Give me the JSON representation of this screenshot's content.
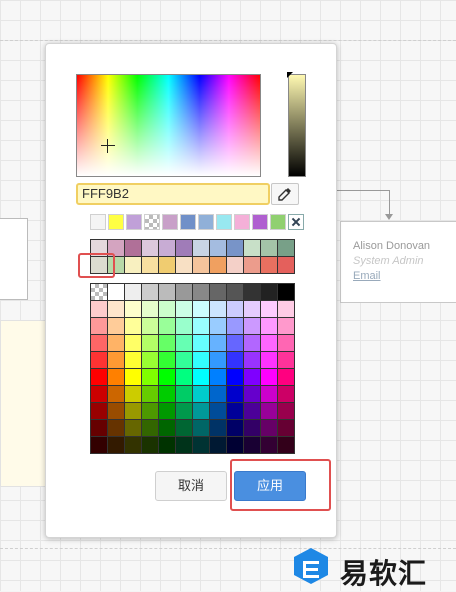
{
  "background": {
    "person_card": {
      "name": "Alison Donovan",
      "role": "System Admin",
      "email_label": "Email"
    }
  },
  "color_picker": {
    "hex_value": "FFF9B2",
    "hue_gradient": [
      "#ff0000",
      "#ffff00",
      "#00ff00",
      "#00ffff",
      "#0000ff",
      "#ff00ff",
      "#ff0000"
    ],
    "brightness_gradient": [
      "#fff9b2",
      "#7f7c59",
      "#000000"
    ],
    "recent_colors": [
      "#f4f4f4",
      "#ffff44",
      "#c0a0d8",
      "checker",
      "#c8a0c8",
      "#7090c8",
      "#90b0d8",
      "#98e8f0",
      "#f4b0d8",
      "#b060d0",
      "#90d070",
      "none"
    ],
    "theme_colors_row1": [
      "#e4d8dc",
      "#d4a4c0",
      "#b07098",
      "#dcc8dc",
      "#c8acd4",
      "#a07cb8",
      "#c8d4e4",
      "#a4bce0",
      "#7894c8",
      "#c8e0c8",
      "#a4c4a8",
      "#78a088"
    ],
    "theme_colors_row2": [
      "#dcdcd0",
      "#b8d8a8",
      "#f8f0c0",
      "#f8e0a0",
      "#f0cc70",
      "#f8e0c4",
      "#f4c49c",
      "#f0a060",
      "#f4d0c8",
      "#ec9c8c",
      "#e87060",
      "#e4605c"
    ],
    "palette_rows": [
      [
        "checker",
        "#ffffff",
        "#eeeeee",
        "#cccccc",
        "#bbbbbb",
        "#999999",
        "#888888",
        "#666666",
        "#555555",
        "#333333",
        "#222222",
        "#000000"
      ],
      [
        "#ffcccc",
        "#ffe6cc",
        "#ffffcc",
        "#e6ffcc",
        "#ccffcc",
        "#ccffe6",
        "#ccffff",
        "#cce5ff",
        "#ccccff",
        "#e5ccff",
        "#ffccff",
        "#ffcce5"
      ],
      [
        "#ff9999",
        "#ffcc99",
        "#ffff99",
        "#ccff99",
        "#99ff99",
        "#99ffcc",
        "#99ffff",
        "#99ccff",
        "#9999ff",
        "#cc99ff",
        "#ff99ff",
        "#ff99cc"
      ],
      [
        "#ff6666",
        "#ffb366",
        "#ffff66",
        "#b3ff66",
        "#66ff66",
        "#66ffb3",
        "#66ffff",
        "#66b2ff",
        "#6666ff",
        "#b266ff",
        "#ff66ff",
        "#ff66b3"
      ],
      [
        "#ff3333",
        "#ff9933",
        "#ffff33",
        "#99ff33",
        "#33ff33",
        "#33ff99",
        "#33ffff",
        "#3399ff",
        "#3333ff",
        "#9933ff",
        "#ff33ff",
        "#ff3399"
      ],
      [
        "#ff0000",
        "#ff8000",
        "#ffff00",
        "#80ff00",
        "#00ff00",
        "#00ff80",
        "#00ffff",
        "#0080ff",
        "#0000ff",
        "#7f00ff",
        "#ff00ff",
        "#ff0080"
      ],
      [
        "#cc0000",
        "#cc6600",
        "#cccc00",
        "#66cc00",
        "#00cc00",
        "#00cc66",
        "#00cccc",
        "#0066cc",
        "#0000cc",
        "#6600cc",
        "#cc00cc",
        "#cc0066"
      ],
      [
        "#990000",
        "#994c00",
        "#999900",
        "#4d9900",
        "#009900",
        "#00994c",
        "#009999",
        "#004c99",
        "#000099",
        "#4c0099",
        "#990099",
        "#99004d"
      ],
      [
        "#660000",
        "#663300",
        "#666600",
        "#336600",
        "#006600",
        "#006633",
        "#006666",
        "#003366",
        "#000066",
        "#330066",
        "#660066",
        "#660033"
      ],
      [
        "#330000",
        "#331a00",
        "#333300",
        "#1a3300",
        "#003300",
        "#00331a",
        "#003333",
        "#001933",
        "#000033",
        "#190033",
        "#330033",
        "#33001a"
      ]
    ],
    "cancel_label": "取消",
    "apply_label": "应用"
  },
  "watermark": {
    "text": "易软汇"
  }
}
